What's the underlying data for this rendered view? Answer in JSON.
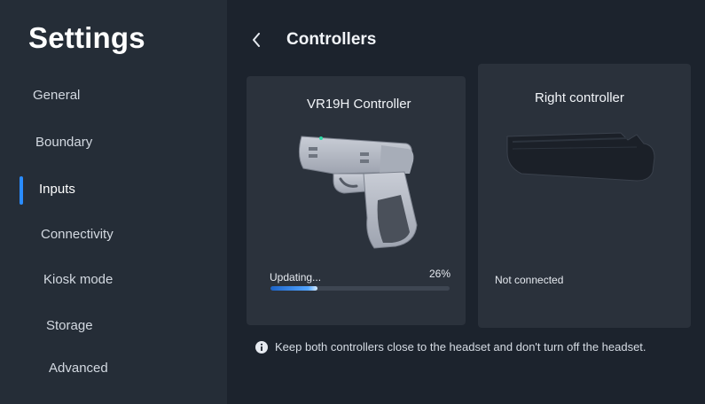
{
  "sidebar": {
    "title": "Settings",
    "items": [
      {
        "label": "General",
        "active": false
      },
      {
        "label": "Boundary",
        "active": false
      },
      {
        "label": "Inputs",
        "active": true
      },
      {
        "label": "Connectivity",
        "active": false
      },
      {
        "label": "Kiosk mode",
        "active": false
      },
      {
        "label": "Storage",
        "active": false
      },
      {
        "label": "Advanced",
        "active": false
      }
    ]
  },
  "header": {
    "back_icon": "chevron-left-icon",
    "title": "Controllers"
  },
  "controllers": [
    {
      "name": "VR19H Controller",
      "status_label": "Updating...",
      "progress_text": "26%",
      "progress": 0.26,
      "image": "controller-gun-image"
    },
    {
      "name": "Right controller",
      "status_label": "Not connected",
      "image": "controller-silhouette-image"
    }
  ],
  "notice": {
    "icon": "info-icon",
    "text": "Keep both controllers close to the headset and don't turn off the headset."
  },
  "colors": {
    "accent": "#2a8cff",
    "sidebar_bg": "#252d37",
    "main_bg": "#1c232d",
    "card_bg": "#2b323c"
  }
}
